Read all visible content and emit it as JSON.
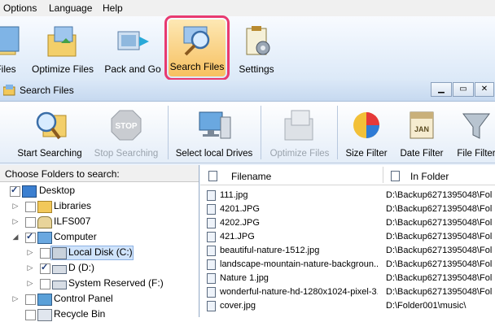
{
  "menubar": {
    "items": [
      "Options",
      "Language",
      "Help"
    ]
  },
  "main_toolbar": {
    "buttons": [
      {
        "label": "Files",
        "icon": "files-icon"
      },
      {
        "label": "Optimize Files",
        "icon": "optimize-files-icon"
      },
      {
        "label": "Pack and Go",
        "icon": "pack-and-go-icon"
      },
      {
        "label": "Search Files",
        "icon": "search-files-icon",
        "highlighted": true
      },
      {
        "label": "Settings",
        "icon": "settings-icon"
      }
    ],
    "highlight_color": "#e83a70"
  },
  "window": {
    "title": "Search Files"
  },
  "sub_toolbar": {
    "buttons": [
      {
        "label": "Start Searching",
        "enabled": true
      },
      {
        "label": "Stop Searching",
        "enabled": false
      },
      {
        "label": "Select local Drives",
        "enabled": true
      },
      {
        "label": "Optimize Files",
        "enabled": false
      },
      {
        "label": "Size Filter",
        "enabled": true
      },
      {
        "label": "Date Filter",
        "enabled": true
      },
      {
        "label": "File Filter",
        "enabled": true
      }
    ]
  },
  "folder_tree": {
    "header": "Choose Folders to search:",
    "nodes": [
      {
        "label": "Desktop",
        "level": 0,
        "checked": true,
        "expander": ""
      },
      {
        "label": "Libraries",
        "level": 1,
        "checked": false,
        "expander": "▷"
      },
      {
        "label": "ILFS007",
        "level": 1,
        "checked": false,
        "expander": "▷"
      },
      {
        "label": "Computer",
        "level": 1,
        "checked": true,
        "expander": "◢"
      },
      {
        "label": "Local Disk (C:)",
        "level": 2,
        "checked": false,
        "expander": "▷",
        "selected": true
      },
      {
        "label": "D (D:)",
        "level": 2,
        "checked": true,
        "expander": "▷"
      },
      {
        "label": "System Reserved (F:)",
        "level": 2,
        "checked": false,
        "expander": "▷"
      },
      {
        "label": "Control Panel",
        "level": 1,
        "checked": false,
        "expander": "▷"
      },
      {
        "label": "Recycle Bin",
        "level": 1,
        "checked": false,
        "expander": ""
      }
    ]
  },
  "file_grid": {
    "columns": [
      "Filename",
      "In Folder"
    ],
    "rows": [
      {
        "name": "111.jpg",
        "folder": "D:\\Backup6271395048\\Fol"
      },
      {
        "name": "4201.JPG",
        "folder": "D:\\Backup6271395048\\Fol"
      },
      {
        "name": "4202.JPG",
        "folder": "D:\\Backup6271395048\\Fol"
      },
      {
        "name": "421.JPG",
        "folder": "D:\\Backup6271395048\\Fol"
      },
      {
        "name": "beautiful-nature-1512.jpg",
        "folder": "D:\\Backup6271395048\\Fol"
      },
      {
        "name": "landscape-mountain-nature-backgroun...",
        "folder": "D:\\Backup6271395048\\Fol"
      },
      {
        "name": "Nature 1.jpg",
        "folder": "D:\\Backup6271395048\\Fol"
      },
      {
        "name": "wonderful-nature-hd-1280x1024-pixel-3...",
        "folder": "D:\\Backup6271395048\\Fol"
      },
      {
        "name": "cover.jpg",
        "folder": "D:\\Folder001\\music\\"
      }
    ]
  }
}
